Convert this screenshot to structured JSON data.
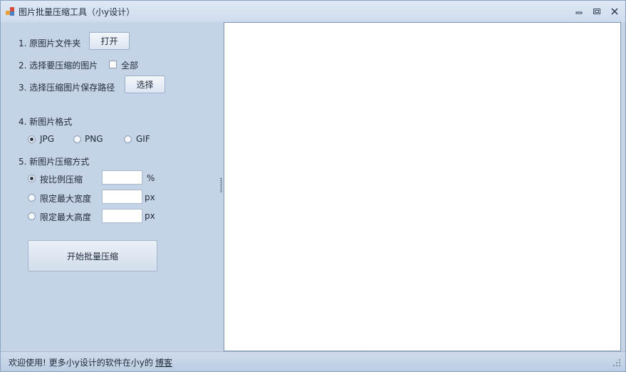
{
  "window": {
    "title": "图片批量压缩工具（小y设计）"
  },
  "controls": {
    "minimize_icon": "minimize-icon",
    "maximize_icon": "restore-icon",
    "close_icon": "close-icon"
  },
  "steps": {
    "source_label": "1. 原图片文件夹",
    "open_button": "打开",
    "select_images_label": "2. 选择要压缩的图片",
    "all_checkbox_label": "全部",
    "all_checked": false,
    "save_path_label": "3. 选择压缩图片保存路径",
    "select_button": "选择",
    "format_label": "4. 新图片格式",
    "formats": [
      {
        "label": "JPG",
        "checked": true
      },
      {
        "label": "PNG",
        "checked": false
      },
      {
        "label": "GIF",
        "checked": false
      }
    ],
    "method_label": "5. 新图片压缩方式",
    "methods": [
      {
        "label": "按比例压缩",
        "value": "",
        "unit": "%",
        "checked": true
      },
      {
        "label": "限定最大宽度",
        "value": "",
        "unit": "px",
        "checked": false
      },
      {
        "label": "限定最大高度",
        "value": "",
        "unit": "px",
        "checked": false
      }
    ],
    "start_button": "开始批量压缩"
  },
  "status": {
    "text": "欢迎使用! 更多小y设计的软件在小y的",
    "link": "博客"
  },
  "colors": {
    "background": "#c4d3e6",
    "preview_bg": "#ffffff",
    "border": "#7e93b2"
  }
}
